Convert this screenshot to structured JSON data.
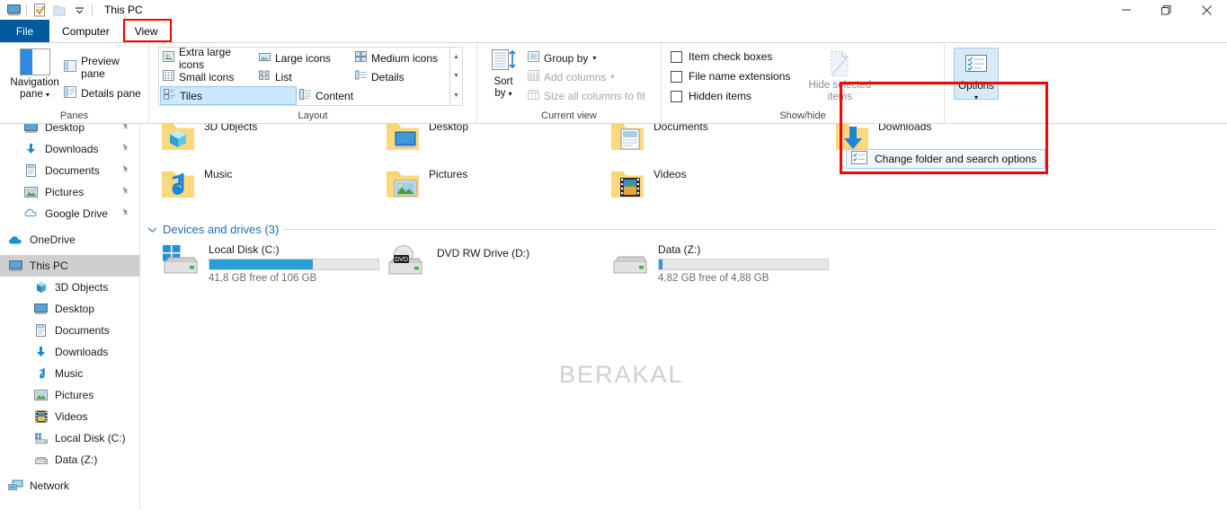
{
  "window": {
    "title": "This PC",
    "quick_access": [
      "this-pc-icon",
      "properties-icon",
      "new-folder-icon",
      "customize-caret"
    ],
    "controls": {
      "minimize": "minimize-icon",
      "maximize": "maximize-icon",
      "close": "close-icon"
    },
    "ribbon_collapse": "collapse-ribbon-icon",
    "help": "help-icon"
  },
  "tabs": [
    {
      "label": "File",
      "id": "file"
    },
    {
      "label": "Computer",
      "id": "computer"
    },
    {
      "label": "View",
      "id": "view",
      "active": true,
      "highlighted": true
    }
  ],
  "ribbon": {
    "panes": {
      "label": "Panes",
      "navigation_pane": "Navigation\npane",
      "navigation_pane_line1": "Navigation",
      "navigation_pane_line2": "pane",
      "preview_pane": "Preview pane",
      "details_pane": "Details pane"
    },
    "layout": {
      "label": "Layout",
      "views": [
        {
          "label": "Extra large icons",
          "selected": false
        },
        {
          "label": "Large icons",
          "selected": false
        },
        {
          "label": "Medium icons",
          "selected": false
        },
        {
          "label": "Small icons",
          "selected": false
        },
        {
          "label": "List",
          "selected": false
        },
        {
          "label": "Details",
          "selected": false
        },
        {
          "label": "Tiles",
          "selected": true
        },
        {
          "label": "Content",
          "selected": false
        }
      ]
    },
    "current_view": {
      "label": "Current view",
      "sort_by_line1": "Sort",
      "sort_by_line2": "by",
      "group_by": "Group by",
      "add_columns": "Add columns",
      "size_all_columns": "Size all columns to fit"
    },
    "show_hide": {
      "label": "Show/hide",
      "item_check_boxes": "Item check boxes",
      "file_name_extensions": "File name extensions",
      "hidden_items": "Hidden items",
      "hide_selected_line1": "Hide selected",
      "hide_selected_line2": "items",
      "checked": [
        false,
        false,
        false
      ]
    },
    "options": {
      "button_label": "Options",
      "menu_item": "Change folder and search options",
      "highlight_color": "#ff0000"
    }
  },
  "sidebar": {
    "quick_access": [
      {
        "label": "Desktop",
        "icon": "desktop-icon",
        "pinned": true,
        "indent": 1
      },
      {
        "label": "Downloads",
        "icon": "downloads-icon",
        "pinned": true,
        "indent": 1
      },
      {
        "label": "Documents",
        "icon": "documents-icon",
        "pinned": true,
        "indent": 1
      },
      {
        "label": "Pictures",
        "icon": "pictures-icon",
        "pinned": true,
        "indent": 1
      },
      {
        "label": "Google Drive",
        "icon": "google-drive-icon",
        "pinned": true,
        "indent": 1
      }
    ],
    "onedrive": {
      "label": "OneDrive",
      "icon": "onedrive-cloud-icon"
    },
    "this_pc": {
      "label": "This PC",
      "icon": "this-pc-icon",
      "selected": true
    },
    "this_pc_children": [
      {
        "label": "3D Objects",
        "icon": "3d-objects-icon"
      },
      {
        "label": "Desktop",
        "icon": "desktop-icon"
      },
      {
        "label": "Documents",
        "icon": "documents-icon"
      },
      {
        "label": "Downloads",
        "icon": "downloads-icon"
      },
      {
        "label": "Music",
        "icon": "music-icon"
      },
      {
        "label": "Pictures",
        "icon": "pictures-icon"
      },
      {
        "label": "Videos",
        "icon": "videos-icon"
      },
      {
        "label": "Local Disk (C:)",
        "icon": "local-disk-icon"
      },
      {
        "label": "Data (Z:)",
        "icon": "hard-drive-icon"
      }
    ],
    "network": {
      "label": "Network",
      "icon": "network-icon"
    }
  },
  "content": {
    "watermark": "BERAKAL",
    "folders_row1": [
      {
        "label": "3D Objects",
        "icon": "folder-3d-objects"
      },
      {
        "label": "Desktop",
        "icon": "folder-desktop"
      },
      {
        "label": "Documents",
        "icon": "folder-documents"
      },
      {
        "label": "Downloads",
        "icon": "folder-downloads"
      }
    ],
    "folders_row2": [
      {
        "label": "Music",
        "icon": "folder-music"
      },
      {
        "label": "Pictures",
        "icon": "folder-pictures"
      },
      {
        "label": "Videos",
        "icon": "folder-videos"
      }
    ],
    "devices_header": "Devices and drives (3)",
    "drives": [
      {
        "name": "Local Disk (C:)",
        "free_text": "41,8 GB free of 106 GB",
        "used_percent": 61,
        "icon": "windows-disk-icon",
        "has_bar": true
      },
      {
        "name": "DVD RW Drive (D:)",
        "free_text": "",
        "used_percent": 0,
        "icon": "dvd-drive-icon",
        "has_bar": false
      },
      {
        "name": "Data (Z:)",
        "free_text": "4,82 GB free of 4,88 GB",
        "used_percent": 2,
        "icon": "hard-drive-icon",
        "has_bar": true
      }
    ]
  }
}
